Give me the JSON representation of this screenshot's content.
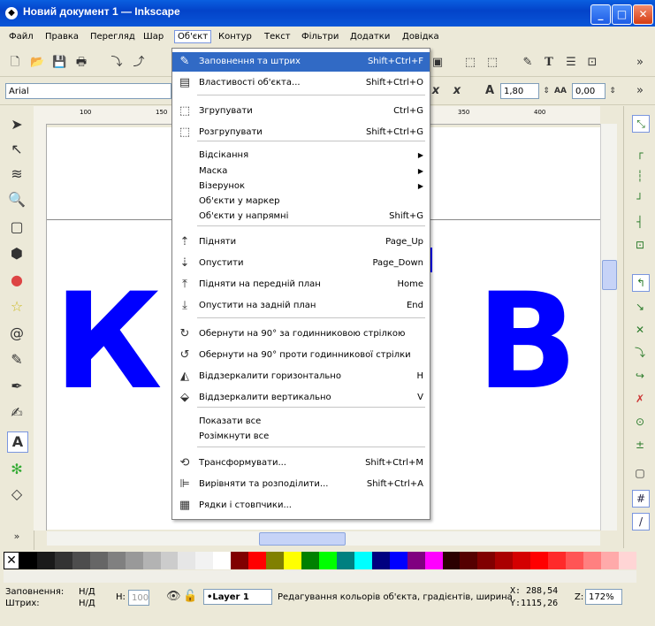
{
  "window": {
    "title": "Новий документ 1 — Inkscape",
    "minimize": "_",
    "maximize": "□",
    "close": "✕"
  },
  "menubar": [
    "Файл",
    "Правка",
    "Перегляд",
    "Шар",
    "Об'єкт",
    "Контур",
    "Текст",
    "Фільтри",
    "Додатки",
    "Довідка"
  ],
  "text_toolbar": {
    "font": "Arial",
    "line_spacing": "1,80",
    "letter_spacing": "0,00"
  },
  "object_menu": {
    "items": [
      {
        "label": "Заповнення та штрих",
        "shortcut": "Shift+Ctrl+F",
        "icon": "fill-stroke-icon",
        "highlighted": true
      },
      {
        "label": "Властивості об'єкта...",
        "shortcut": "Shift+Ctrl+O",
        "icon": "object-properties-icon"
      },
      {
        "label": "Згрупувати",
        "shortcut": "Ctrl+G",
        "icon": "group-icon"
      },
      {
        "label": "Розгрупувати",
        "shortcut": "Shift+Ctrl+G",
        "icon": "ungroup-icon"
      },
      {
        "label": "Відсікання",
        "submenu": true
      },
      {
        "label": "Маска",
        "submenu": true
      },
      {
        "label": "Візерунок",
        "submenu": true
      },
      {
        "label": "Об'єкти у маркер",
        "shortcut": ""
      },
      {
        "label": "Об'єкти у напрямні",
        "shortcut": "Shift+G"
      },
      {
        "label": "Підняти",
        "shortcut": "Page_Up",
        "icon": "raise-icon"
      },
      {
        "label": "Опустити",
        "shortcut": "Page_Down",
        "icon": "lower-icon"
      },
      {
        "label": "Підняти на передній план",
        "shortcut": "Home",
        "icon": "raise-to-top-icon"
      },
      {
        "label": "Опустити на задній план",
        "shortcut": "End",
        "icon": "lower-to-bottom-icon"
      },
      {
        "label": "Обернути на 90° за годинниковою стрілкою",
        "shortcut": "",
        "icon": "rotate-cw-icon"
      },
      {
        "label": "Обернути на 90° проти годинникової стрілки",
        "shortcut": "",
        "icon": "rotate-ccw-icon"
      },
      {
        "label": "Віддзеркалити горизонтально",
        "shortcut": "H",
        "icon": "flip-horizontal-icon"
      },
      {
        "label": "Віддзеркалити вертикально",
        "shortcut": "V",
        "icon": "flip-vertical-icon"
      },
      {
        "label": "Показати все",
        "shortcut": ""
      },
      {
        "label": "Розімкнути все",
        "shortcut": ""
      },
      {
        "label": "Трансформувати...",
        "shortcut": "Shift+Ctrl+M",
        "icon": "transform-icon"
      },
      {
        "label": "Вирівняти та розподілити...",
        "shortcut": "Shift+Ctrl+A",
        "icon": "align-icon"
      },
      {
        "label": "Рядки і стовпчики...",
        "shortcut": "",
        "icon": "rows-columns-icon"
      }
    ]
  },
  "canvas": {
    "letter_left": "К",
    "letter_right": "В",
    "ruler_marks": [
      "100",
      "150",
      "350",
      "400"
    ]
  },
  "palette": [
    "#000000",
    "#1a1a1a",
    "#333333",
    "#4d4d4d",
    "#666666",
    "#808080",
    "#999999",
    "#b3b3b3",
    "#cccccc",
    "#e6e6e6",
    "#f2f2f2",
    "#ffffff",
    "#800000",
    "#ff0000",
    "#808000",
    "#ffff00",
    "#008000",
    "#00ff00",
    "#008080",
    "#00ffff",
    "#000080",
    "#0000ff",
    "#800080",
    "#ff00ff",
    "#2b0000",
    "#550000",
    "#800000",
    "#aa0000",
    "#d40000",
    "#ff0000",
    "#ff2a2a",
    "#ff5555",
    "#ff8080",
    "#ffaaaa",
    "#ffd5d5"
  ],
  "status": {
    "fill_label": "Заповнення:",
    "stroke_label": "Штрих:",
    "fill_value": "Н/Д",
    "stroke_value": "Н/Д",
    "h_label": "Н:",
    "h_value": "100",
    "layer": "•Layer 1",
    "message": "Редагування кольорів об'єкта, градієнтів, ширина",
    "x_label": "X:",
    "x_value": "288,54",
    "y_label": "Y:",
    "y_value": "1115,26",
    "zoom_label": "Z:",
    "zoom_value": "172%"
  }
}
